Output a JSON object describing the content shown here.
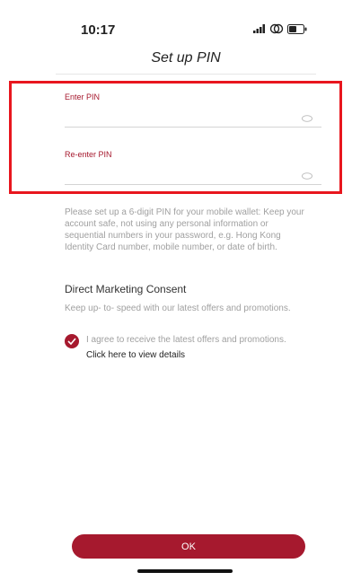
{
  "status_bar": {
    "time": "10:17",
    "icons": [
      "signal-icon",
      "wifi-icon",
      "battery-icon"
    ]
  },
  "header": {
    "title": "Set up PIN"
  },
  "pin_form": {
    "enter_label": "Enter PIN",
    "enter_value": "",
    "reenter_label": "Re-enter PIN",
    "reenter_value": ""
  },
  "info_text": "Please set up a 6-digit PIN for your mobile wallet: Keep your account safe, not using any personal information or sequential numbers in your password, e.g. Hong Kong Identity Card number, mobile number, or date of birth.",
  "marketing": {
    "title": "Direct Marketing Consent",
    "description": "Keep up- to- speed with our latest offers and promotions.",
    "consent_checked": true,
    "consent_text": "I agree to receive the latest offers and promotions.",
    "details_link": "Click here to view details"
  },
  "ok_button": {
    "label": "OK"
  },
  "colors": {
    "accent": "#a6192e",
    "highlight_border": "#e8161e"
  }
}
